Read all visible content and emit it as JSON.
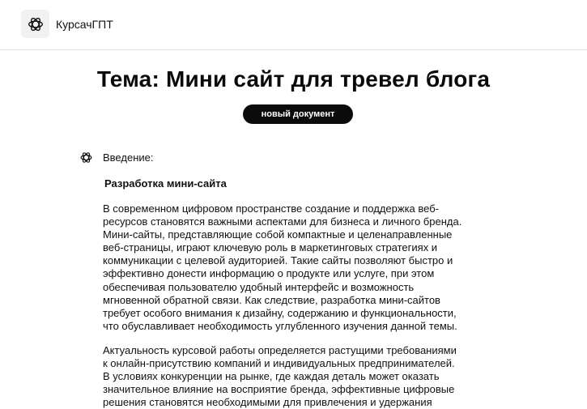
{
  "header": {
    "app_name": "КурсачГПТ",
    "logo_icon": "openai-logo-icon"
  },
  "main": {
    "title": "Тема: Мини сайт для тревел блога",
    "new_document_label": "новый документ",
    "assistant_icon": "openai-logo-icon",
    "intro_label": "Введение:",
    "section_heading": "Разработка мини-сайта",
    "paragraphs": [
      "В современном цифровом пространстве создание и поддержка веб-\nресурсов становятся важными аспектами для бизнеса и личного бренда.\nМини-сайты, представляющие собой компактные и целенаправленные\nвеб-страницы, играют ключевую роль в маркетинговых стратегиях и\nкоммуникации с целевой аудиторией. Такие сайты позволяют быстро и\nэффективно донести информацию о продукте или услуге, при этом\nобеспечивая пользователю удобный интерфейс и возможность\nмгновенной обратной связи. Как следствие, разработка мини-сайтов\nтребует особого внимания к дизайну, содержанию и функциональности,\nчто обуславливает необходимость углубленного изучения данной темы.",
      "Актуальность курсовой работы определяется растущими требованиями\nк онлайн-присутствию компаний и индивидуальных предпринимателей.\nВ условиях конкуренции на рынке, где каждая деталь может оказать\nзначительное влияние на восприятие бренда, эффективные цифровые\nрешения становятся необходимыми для привлечения и удержания"
    ]
  }
}
